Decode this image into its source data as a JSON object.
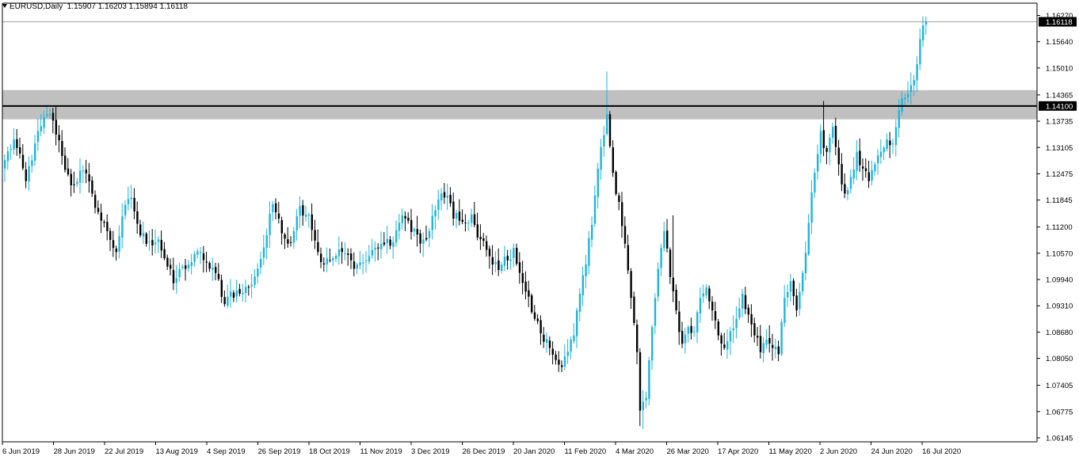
{
  "header": {
    "symbol": "EURUSD,Daily",
    "ohlc": "1.15907 1.16203 1.15894 1.16118"
  },
  "colors": {
    "bull": "#1eb4dc",
    "bear": "#000000",
    "zone": "#c0c0c0",
    "level_line": "#000000",
    "current_line": "#808080",
    "axis": "#000000"
  },
  "chart_data": {
    "type": "candlestick",
    "ylim": [
      1.0605,
      1.1645
    ],
    "y_ticks": [
      "1.16270",
      "1.15640",
      "1.15010",
      "1.14365",
      "1.13735",
      "1.13105",
      "1.12475",
      "1.11845",
      "1.11200",
      "1.10570",
      "1.09940",
      "1.09310",
      "1.08680",
      "1.08050",
      "1.07405",
      "1.06775",
      "1.06145"
    ],
    "x_ticks": [
      "6 Jun 2019",
      "28 Jun 2019",
      "22 Jul 2019",
      "13 Aug 2019",
      "4 Sep 2019",
      "26 Sep 2019",
      "18 Oct 2019",
      "11 Nov 2019",
      "3 Dec 2019",
      "26 Dec 2019",
      "20 Jan 2020",
      "11 Feb 2020",
      "4 Mar 2020",
      "26 Mar 2020",
      "17 Apr 2020",
      "11 May 2020",
      "2 Jun 2020",
      "24 Jun 2020",
      "16 Jul 2020"
    ],
    "current_price": {
      "value": 1.16118,
      "label": "1.16118"
    },
    "horizontal_level": {
      "value": 1.141,
      "label": "1.14100"
    },
    "zone": {
      "from": 1.1378,
      "to": 1.1448
    },
    "close_anchors": [
      [
        0,
        1.128
      ],
      [
        3,
        1.133
      ],
      [
        7,
        1.123
      ],
      [
        10,
        1.132
      ],
      [
        14,
        1.139
      ],
      [
        16,
        1.1375
      ],
      [
        19,
        1.129
      ],
      [
        22,
        1.122
      ],
      [
        26,
        1.1255
      ],
      [
        29,
        1.12
      ],
      [
        32,
        1.1135
      ],
      [
        34,
        1.111
      ],
      [
        37,
        1.106
      ],
      [
        39,
        1.1145
      ],
      [
        42,
        1.119
      ],
      [
        45,
        1.11
      ],
      [
        48,
        1.1085
      ],
      [
        51,
        1.109
      ],
      [
        53,
        1.1045
      ],
      [
        56,
        1.0985
      ],
      [
        59,
        1.1025
      ],
      [
        62,
        1.1035
      ],
      [
        65,
        1.106
      ],
      [
        68,
        1.102
      ],
      [
        71,
        1.0995
      ],
      [
        73,
        1.0935
      ],
      [
        75,
        1.0965
      ],
      [
        78,
        1.096
      ],
      [
        81,
        1.0975
      ],
      [
        84,
        1.102
      ],
      [
        87,
        1.11
      ],
      [
        89,
        1.1175
      ],
      [
        91,
        1.114
      ],
      [
        94,
        1.108
      ],
      [
        96,
        1.111
      ],
      [
        98,
        1.117
      ],
      [
        101,
        1.115
      ],
      [
        104,
        1.106
      ],
      [
        106,
        1.103
      ],
      [
        109,
        1.1045
      ],
      [
        112,
        1.106
      ],
      [
        115,
        1.104
      ],
      [
        117,
        1.103
      ],
      [
        120,
        1.104
      ],
      [
        123,
        1.107
      ],
      [
        125,
        1.108
      ],
      [
        128,
        1.1075
      ],
      [
        131,
        1.113
      ],
      [
        133,
        1.114
      ],
      [
        136,
        1.1115
      ],
      [
        138,
        1.108
      ],
      [
        140,
        1.109
      ],
      [
        143,
        1.116
      ],
      [
        145,
        1.12
      ],
      [
        147,
        1.1195
      ],
      [
        149,
        1.114
      ],
      [
        151,
        1.1135
      ],
      [
        153,
        1.113
      ],
      [
        155,
        1.115
      ],
      [
        157,
        1.1095
      ],
      [
        160,
        1.1065
      ],
      [
        162,
        1.103
      ],
      [
        165,
        1.103
      ],
      [
        167,
        1.104
      ],
      [
        169,
        1.107
      ],
      [
        171,
        1.101
      ],
      [
        173,
        1.0965
      ],
      [
        176,
        1.09
      ],
      [
        178,
        1.0865
      ],
      [
        181,
        1.083
      ],
      [
        184,
        1.079
      ],
      [
        186,
        1.081
      ],
      [
        189,
        1.086
      ],
      [
        191,
        1.096
      ],
      [
        193,
        1.103
      ],
      [
        195,
        1.1125
      ],
      [
        197,
        1.126
      ],
      [
        199,
        1.134
      ],
      [
        200,
        1.139
      ],
      [
        202,
        1.125
      ],
      [
        204,
        1.118
      ],
      [
        206,
        1.108
      ],
      [
        208,
        1.095
      ],
      [
        210,
        1.082
      ],
      [
        211,
        1.068
      ],
      [
        213,
        1.071
      ],
      [
        215,
        1.088
      ],
      [
        217,
        1.102
      ],
      [
        219,
        1.111
      ],
      [
        221,
        1.1
      ],
      [
        223,
        1.092
      ],
      [
        225,
        1.084
      ],
      [
        227,
        1.088
      ],
      [
        229,
        1.087
      ],
      [
        231,
        1.095
      ],
      [
        233,
        1.0975
      ],
      [
        235,
        1.092
      ],
      [
        237,
        1.086
      ],
      [
        239,
        1.083
      ],
      [
        241,
        1.087
      ],
      [
        243,
        1.09
      ],
      [
        245,
        1.096
      ],
      [
        247,
        1.091
      ],
      [
        249,
        1.086
      ],
      [
        251,
        1.082
      ],
      [
        253,
        1.085
      ],
      [
        255,
        1.083
      ],
      [
        257,
        1.0815
      ],
      [
        259,
        1.095
      ],
      [
        261,
        1.099
      ],
      [
        263,
        1.092
      ],
      [
        265,
        1.101
      ],
      [
        267,
        1.113
      ],
      [
        269,
        1.125
      ],
      [
        271,
        1.135
      ],
      [
        273,
        1.13
      ],
      [
        275,
        1.136
      ],
      [
        277,
        1.127
      ],
      [
        279,
        1.12
      ],
      [
        281,
        1.124
      ],
      [
        283,
        1.13
      ],
      [
        285,
        1.126
      ],
      [
        287,
        1.123
      ],
      [
        289,
        1.127
      ],
      [
        291,
        1.13
      ],
      [
        293,
        1.133
      ],
      [
        295,
        1.132
      ],
      [
        297,
        1.14
      ],
      [
        299,
        1.143
      ],
      [
        301,
        1.146
      ],
      [
        303,
        1.151
      ],
      [
        304,
        1.157
      ],
      [
        306,
        1.1612
      ]
    ],
    "high_marks": [
      [
        14,
        1.1412
      ],
      [
        200,
        1.1493
      ],
      [
        211,
        1.0643
      ],
      [
        212,
        1.0636
      ],
      [
        222,
        1.1148
      ],
      [
        272,
        1.1422
      ],
      [
        298,
        1.1445
      ],
      [
        305,
        1.1625
      ]
    ]
  }
}
